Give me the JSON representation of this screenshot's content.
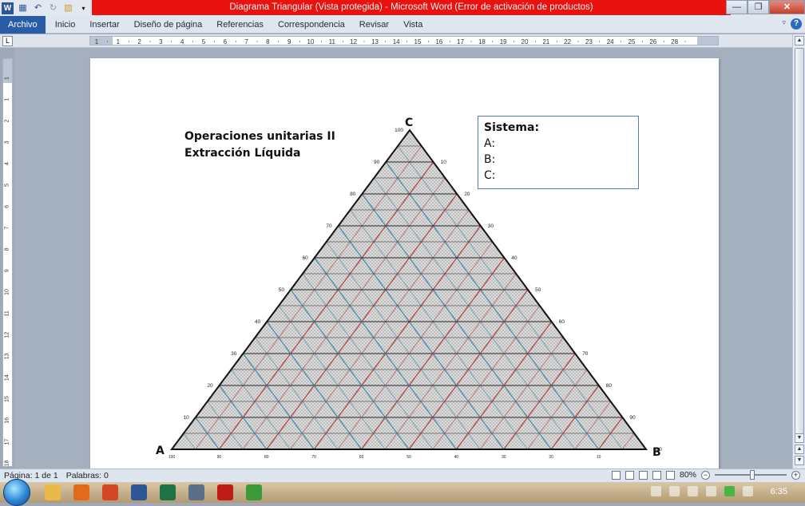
{
  "window": {
    "title": "Diagrama Triangular (Vista protegida) - Microsoft Word (Error de activación de productos)",
    "app_icon": "W"
  },
  "tabs": [
    {
      "label": "Archivo"
    },
    {
      "label": "Inicio"
    },
    {
      "label": "Insertar"
    },
    {
      "label": "Diseño de página"
    },
    {
      "label": "Referencias"
    },
    {
      "label": "Correspondencia"
    },
    {
      "label": "Revisar"
    },
    {
      "label": "Vista"
    }
  ],
  "ruler": {
    "labels": [
      "1",
      "1",
      "2",
      "3",
      "4",
      "5",
      "6",
      "7",
      "8",
      "9",
      "10",
      "11",
      "12",
      "13",
      "14",
      "15",
      "16",
      "17",
      "18",
      "19",
      "20",
      "21",
      "22",
      "23",
      "24",
      "25",
      "26",
      "28"
    ],
    "corner": "L",
    "vertical_labels": [
      "1",
      "1",
      "2",
      "3",
      "4",
      "5",
      "6",
      "7",
      "8",
      "9",
      "10",
      "11",
      "12",
      "13",
      "14",
      "15",
      "16",
      "17",
      "18"
    ]
  },
  "document": {
    "title_line1": "Operaciones unitarias II",
    "title_line2": "Extracción Líquida",
    "sistema_head": "Sistema:",
    "sistema_a": "A:",
    "sistema_b": "B:",
    "sistema_c": "C:",
    "vertex_a": "A",
    "vertex_b": "B",
    "vertex_c": "C",
    "left_scale": [
      "10",
      "20",
      "30",
      "40",
      "50",
      "60",
      "70",
      "80",
      "90",
      "100"
    ],
    "right_scale": [
      "10",
      "20",
      "30",
      "40",
      "50",
      "60",
      "70",
      "80",
      "90",
      "100"
    ],
    "bottom_scale": [
      "100",
      "90",
      "80",
      "70",
      "60",
      "50",
      "40",
      "30",
      "20",
      "10"
    ]
  },
  "statusbar": {
    "page": "Página: 1 de 1",
    "words": "Palabras: 0",
    "zoom": "80%"
  },
  "taskbar": {
    "time": "6:35",
    "apps": [
      {
        "icon": "folder-icon",
        "color": "#e9b949"
      },
      {
        "icon": "firefox-icon",
        "color": "#e26a1b"
      },
      {
        "icon": "powerpoint-icon",
        "color": "#d24726"
      },
      {
        "icon": "word-icon",
        "color": "#2b5797"
      },
      {
        "icon": "excel-icon",
        "color": "#1f7244"
      },
      {
        "icon": "app-icon",
        "color": "#5c6f8a"
      },
      {
        "icon": "acrobat-icon",
        "color": "#c11b17"
      },
      {
        "icon": "chrome-icon",
        "color": "#3b9b3b"
      }
    ]
  }
}
